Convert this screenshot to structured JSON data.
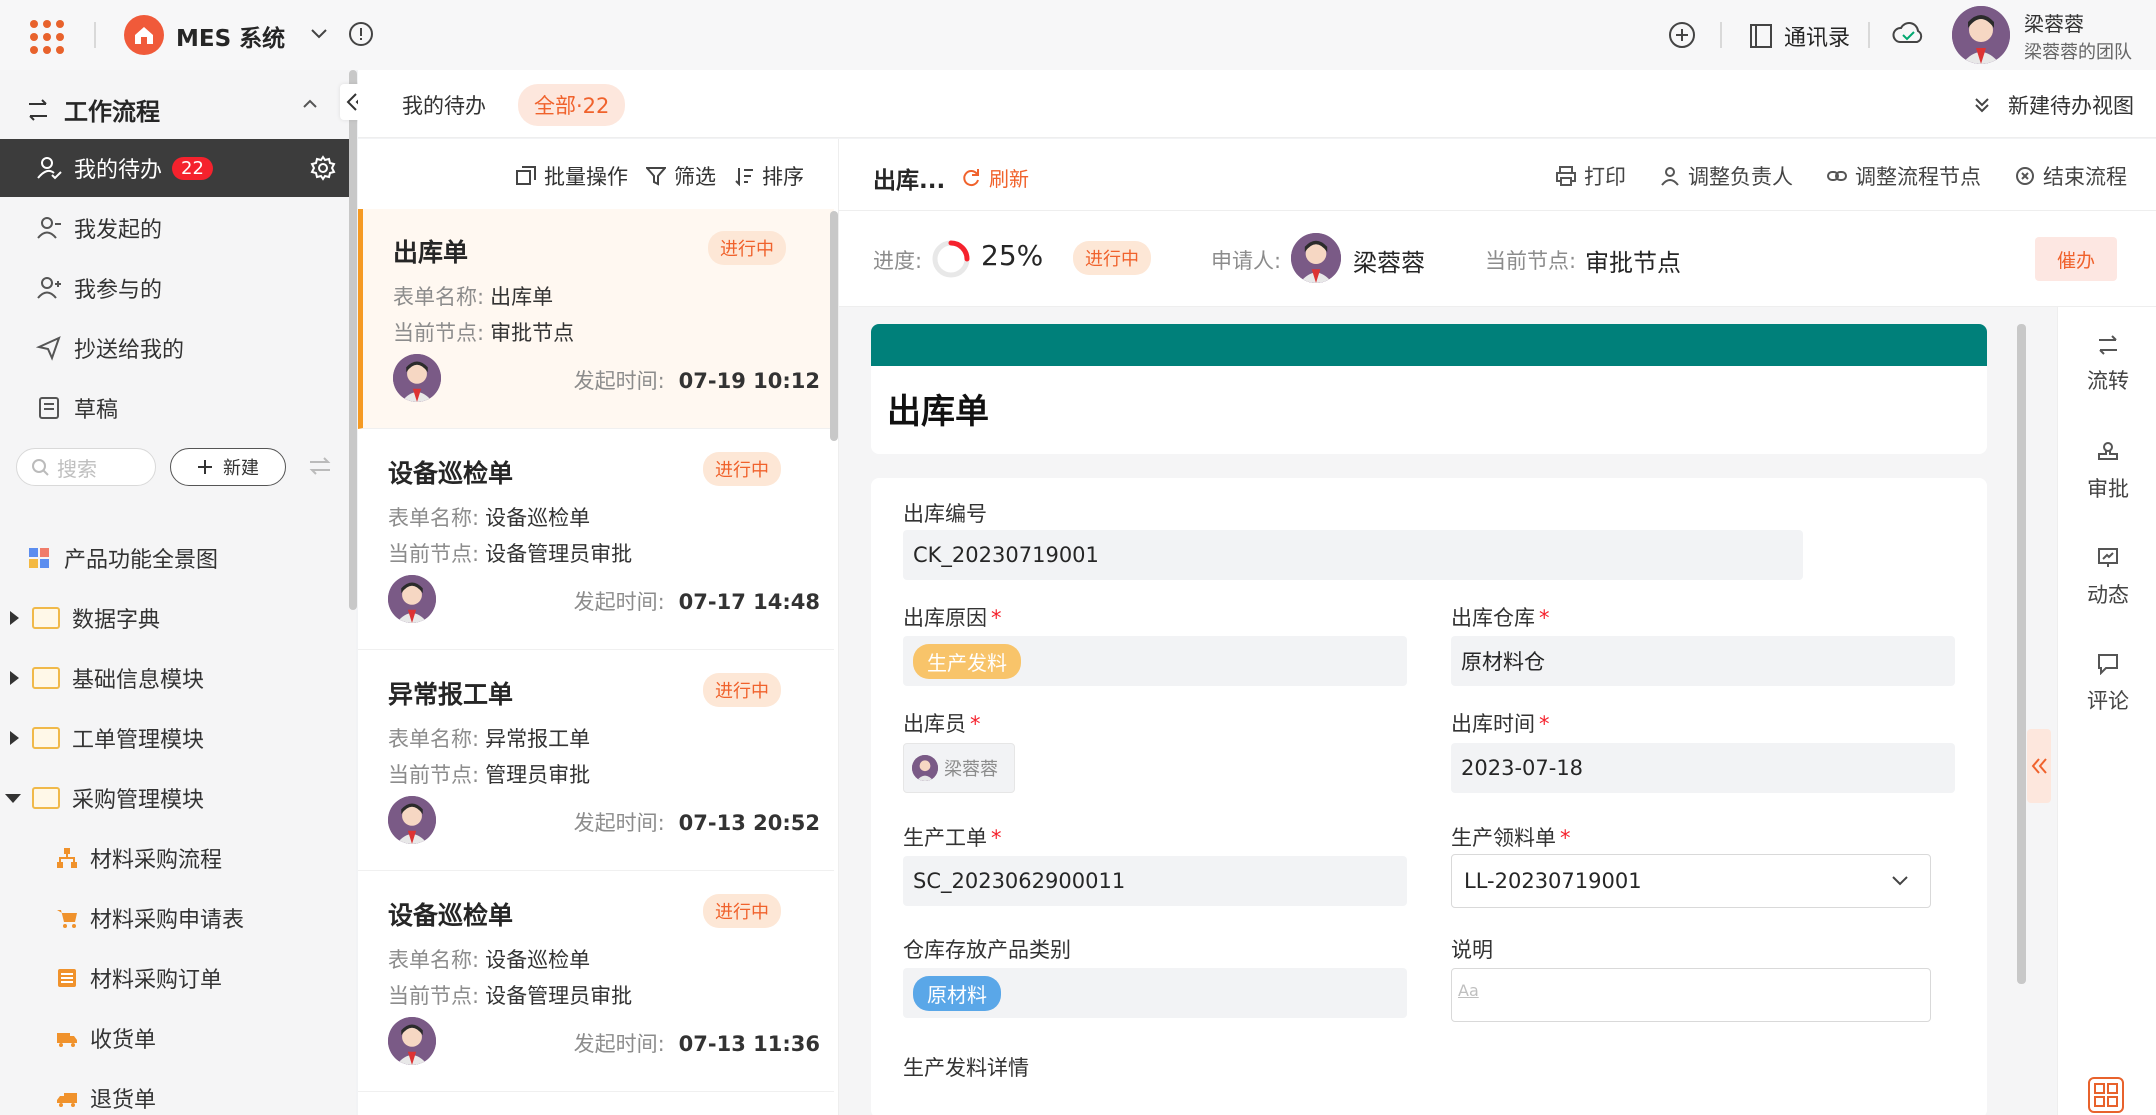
{
  "app": {
    "name": "MES 系统"
  },
  "topbar": {
    "contacts": "通讯录",
    "user_name": "梁蓉蓉",
    "user_team": "梁蓉蓉的团队"
  },
  "sidebar": {
    "section_title": "工作流程",
    "items": [
      {
        "label": "我的待办",
        "badge": "22"
      },
      {
        "label": "我发起的"
      },
      {
        "label": "我参与的"
      },
      {
        "label": "抄送给我的"
      },
      {
        "label": "草稿"
      }
    ],
    "search_placeholder": "搜索",
    "new_label": "新建",
    "tree": [
      {
        "label": "产品功能全景图"
      },
      {
        "label": "数据字典"
      },
      {
        "label": "基础信息模块"
      },
      {
        "label": "工单管理模块"
      },
      {
        "label": "采购管理模块"
      },
      {
        "label": "材料采购流程"
      },
      {
        "label": "材料采购申请表"
      },
      {
        "label": "材料采购订单"
      },
      {
        "label": "收货单"
      },
      {
        "label": "退货单"
      }
    ]
  },
  "tabs": {
    "my_todo": "我的待办",
    "all": "全部·22",
    "new_view": "新建待办视图"
  },
  "list_toolbar": {
    "batch": "批量操作",
    "filter": "筛选",
    "sort": "排序"
  },
  "labels": {
    "form_name": "表单名称:",
    "current_node": "当前节点:",
    "start_time": "发起时间:"
  },
  "cards": [
    {
      "title": "出库单",
      "status": "进行中",
      "form": "出库单",
      "node": "审批节点",
      "time": "07-19 10:12"
    },
    {
      "title": "设备巡检单",
      "status": "进行中",
      "form": "设备巡检单",
      "node": "设备管理员审批",
      "time": "07-17 14:48"
    },
    {
      "title": "异常报工单",
      "status": "进行中",
      "form": "异常报工单",
      "node": "管理员审批",
      "time": "07-13 20:52"
    },
    {
      "title": "设备巡检单",
      "status": "进行中",
      "form": "设备巡检单",
      "node": "设备管理员审批",
      "time": "07-13 11:36"
    }
  ],
  "detail": {
    "title": "出库...",
    "refresh": "刷新",
    "actions": [
      "打印",
      "调整负责人",
      "调整流程节点",
      "结束流程"
    ],
    "progress_label": "进度:",
    "progress_value": "25%",
    "progress_fraction": 0.25,
    "status": "进行中",
    "applicant_label": "申请人:",
    "applicant": "梁蓉蓉",
    "node_label": "当前节点:",
    "node": "审批节点",
    "urge": "催办",
    "form_title": "出库单",
    "fields": {
      "code_label": "出库编号",
      "code": "CK_20230719001",
      "reason_label": "出库原因",
      "reason": "生产发料",
      "warehouse_label": "出库仓库",
      "warehouse": "原材料仓",
      "operator_label": "出库员",
      "operator": "梁蓉蓉",
      "time_label": "出库时间",
      "time": "2023-07-18",
      "workorder_label": "生产工单",
      "workorder": "SC_2023062900011",
      "picklist_label": "生产领料单",
      "picklist": "LL-20230719001",
      "category_label": "仓库存放产品类别",
      "category": "原材料",
      "note_label": "说明",
      "note_placeholder": "Aa",
      "detail_label": "生产发料详情"
    },
    "rightbar": [
      "流转",
      "审批",
      "动态",
      "评论"
    ]
  },
  "colors": {
    "accent": "#f0622c",
    "form_header": "#00807a",
    "sidebar_active": "#3c3c3c"
  }
}
